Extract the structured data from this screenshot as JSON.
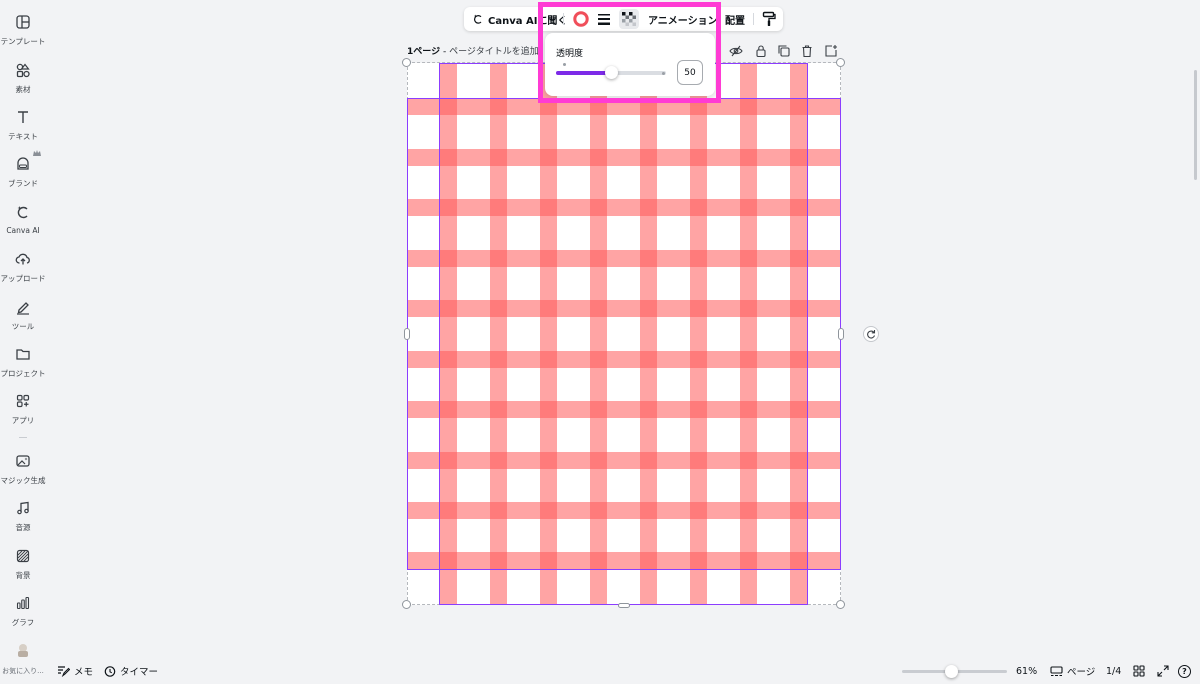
{
  "sidebar": {
    "items": [
      {
        "label": "テンプレート",
        "icon": "template-icon"
      },
      {
        "label": "素材",
        "icon": "elements-icon"
      },
      {
        "label": "テキスト",
        "icon": "text-icon"
      },
      {
        "label": "ブランド",
        "icon": "brand-icon"
      },
      {
        "label": "Canva AI",
        "icon": "canva-ai-icon"
      },
      {
        "label": "アップロード",
        "icon": "upload-icon"
      },
      {
        "label": "ツール",
        "icon": "tools-icon"
      },
      {
        "label": "プロジェクト",
        "icon": "folder-icon"
      },
      {
        "label": "アプリ",
        "icon": "apps-icon"
      },
      {
        "label": "マジック生成",
        "icon": "magic-media-icon"
      },
      {
        "label": "音源",
        "icon": "music-icon"
      },
      {
        "label": "背景",
        "icon": "background-icon"
      },
      {
        "label": "グラフ",
        "icon": "chart-icon"
      }
    ],
    "favorites_label": "お気に入り..."
  },
  "toolbar": {
    "ask_ai_label": "Canva AIに聞く",
    "animation_label": "アニメーション",
    "position_label": "配置",
    "accent_color": "#f04e5a"
  },
  "transparency": {
    "title": "透明度",
    "value": "50",
    "value_number": 50,
    "accent_color": "#7d2ae8"
  },
  "page_header": {
    "page_number": "1ページ",
    "separator": " - ",
    "title_placeholder": "ページタイトルを追加"
  },
  "bottom": {
    "notes_label": "メモ",
    "timer_label": "タイマー",
    "zoom_value": "61%",
    "zoom_fraction": 0.47,
    "pages_label": "ページ",
    "page_count": "1/4",
    "help_label": "?"
  },
  "colors": {
    "selection": "#8b3dff",
    "gingham": "#ff5a5a"
  }
}
